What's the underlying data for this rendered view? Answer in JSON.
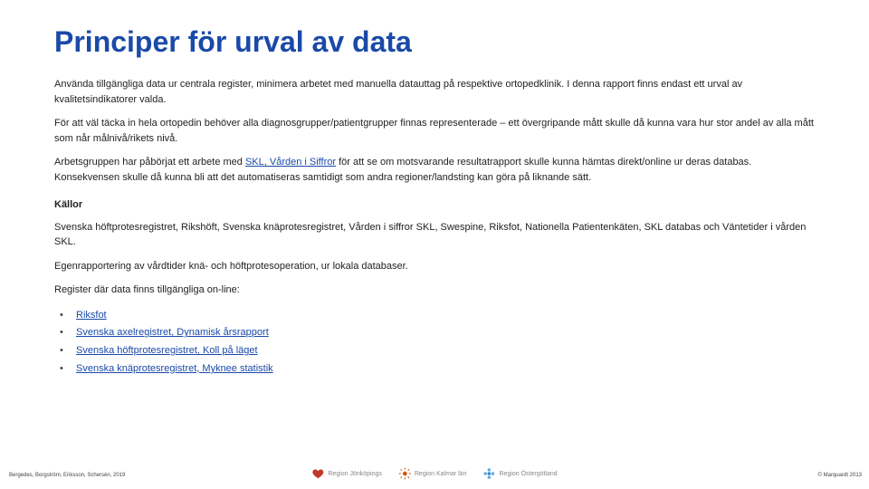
{
  "title": "Principer för urval av data",
  "paragraphs": {
    "p1": "Använda tillgängliga data ur centrala register, minimera arbetet med manuella datauttag på respektive ortopedklinik. I denna rapport finns endast ett urval av kvalitetsindikatorer valda.",
    "p2": "För att väl täcka in hela ortopedin behöver alla diagnosgrupper/patientgrupper finnas representerade – ett övergripande mått skulle då kunna vara hur stor andel av alla mått som når målnivå/rikets nivå.",
    "p3_pre": "Arbetsgruppen har påbörjat ett arbete med ",
    "p3_link": "SKL, Vården i Siffror",
    "p3_post": " för att se om motsvarande resultatrapport skulle kunna hämtas direkt/online ur deras databas. Konsekvensen skulle då kunna bli att det automatiseras samtidigt som andra regioner/landsting kan göra på liknande sätt.",
    "sources_heading": "Källor",
    "sources_body": "Svenska höftprotesregistret, Rikshöft, Svenska knäprotesregistret, Vården i siffror SKL, Swespine, Riksfot, Nationella Patientenkäten, SKL databas och Väntetider i vården SKL.",
    "egen": "Egenrapportering av vårdtider knä- och höftprotesoperation, ur lokala databaser.",
    "online_intro": "Register där data finns tillgängliga on-line:"
  },
  "online_registers": [
    "Riksfot",
    "Svenska axelregistret, Dynamisk årsrapport",
    "Svenska höftprotesregistret, Koll på läget",
    "Svenska knäprotesregistret, Myknee statistik"
  ],
  "footer": {
    "left": "Bergedes, Borgström, Eriksson, Schersén, 2019",
    "right": "© Marquardt 2013",
    "logos": [
      "Region Jönköpings",
      "Region Kalmar län",
      "Region Östergötland"
    ]
  }
}
